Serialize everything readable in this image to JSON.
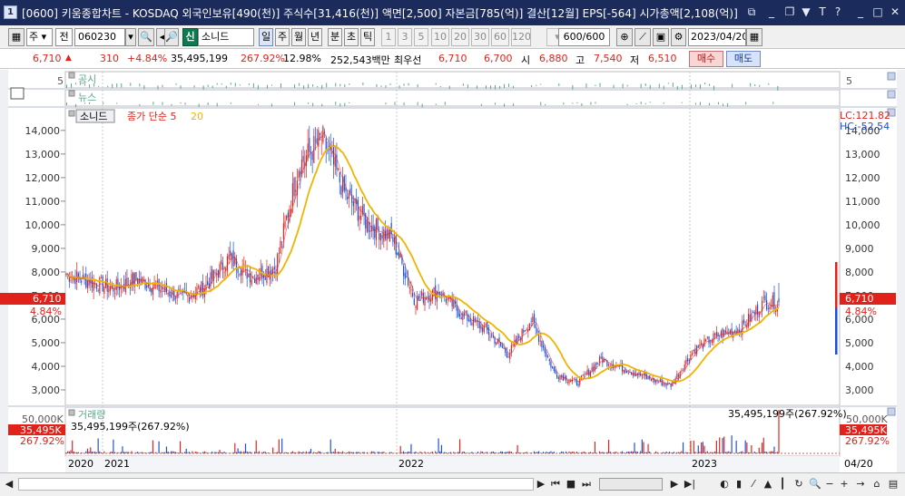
{
  "window": {
    "app_number": "1",
    "title": "[0600] 키움종합차트 - KOSDAQ 외국인보유[490(천)] 주식수[31,416(천)] 액면[2,500] 자본금[785(억)] 결산[12월] EPS[-564] 시가총액[2,108(억)]"
  },
  "toolbar": {
    "kind_label": "주",
    "prev_label": "전",
    "code_value": "060230",
    "credit_label": "신",
    "stock_name": "소니드",
    "periods": [
      "일",
      "주",
      "월",
      "년",
      "분",
      "초",
      "틱"
    ],
    "active_period": "일",
    "intervals": [
      "1",
      "3",
      "5",
      "10",
      "20",
      "30",
      "60",
      "120"
    ],
    "count_value": "600",
    "count_total": "/600",
    "date_value": "2023/04/20"
  },
  "quote": {
    "price": "6,710",
    "change": "310",
    "change_pct": "+4.84%",
    "volume": "35,495,199",
    "volume_ratio": "267.92%",
    "turnover": "12.98%",
    "amount": "252,543백만",
    "best_label": "최우선",
    "best_ask": "6,710",
    "best_bid": "6,700",
    "open_label": "시",
    "open": "6,880",
    "high_label": "고",
    "high": "7,540",
    "low_label": "저",
    "low": "6,510",
    "buy_label": "매수",
    "sell_label": "매도",
    "up_color": "#e0221b",
    "down_color": "#1d4fd6"
  },
  "panels": {
    "disclosure_label": "공시",
    "disclosure_scale": "5",
    "news_label": "뉴스",
    "price_legend_name": "소니드",
    "price_legend_ma": "종가 단순 5",
    "price_legend_ma2": "20",
    "lc_label": "LC:121.82",
    "hc_label": "HC:-52.54",
    "price_tag": "6,710",
    "price_tag_pct": "4.84%",
    "volume_label": "거래량",
    "volume_info_left": "35,495,199주(267.92%)",
    "volume_info_right": "35,495,199주(267.92%)",
    "volume_scale_top": "50,000K",
    "volume_tag": "35,495K",
    "volume_tag_pct": "267.92%"
  },
  "bottom": {
    "date_label": "04/20"
  },
  "chart_data": {
    "type": "candlestick",
    "ylim": [
      2500,
      14800
    ],
    "yticks": [
      "14,000",
      "13,000",
      "12,000",
      "11,000",
      "10,000",
      "9,000",
      "8,000",
      "7,000",
      "6,000",
      "5,000",
      "4,000",
      "3,000"
    ],
    "xticks": [
      "2020",
      "2021",
      "2022",
      "2023"
    ],
    "ma5_color": "#e0221b",
    "ma20_color": "#f0b400",
    "price_path": [
      [
        "2020-10",
        7900
      ],
      [
        "2020-12",
        7300
      ],
      [
        "2021-01",
        7700
      ],
      [
        "2021-03",
        6900
      ],
      [
        "2021-04",
        7400
      ],
      [
        "2021-05",
        8600
      ],
      [
        "2021-06",
        7800
      ],
      [
        "2021-07",
        8200
      ],
      [
        "2021-08",
        12500
      ],
      [
        "2021-09",
        13700
      ],
      [
        "2021-10",
        11300
      ],
      [
        "2021-11",
        10000
      ],
      [
        "2021-12",
        9500
      ],
      [
        "2022-01",
        6800
      ],
      [
        "2022-02",
        7200
      ],
      [
        "2022-03",
        6200
      ],
      [
        "2022-04",
        5600
      ],
      [
        "2022-05",
        4500
      ],
      [
        "2022-06",
        6000
      ],
      [
        "2022-07",
        3700
      ],
      [
        "2022-08",
        3300
      ],
      [
        "2022-09",
        4300
      ],
      [
        "2022-10",
        3900
      ],
      [
        "2022-11",
        3500
      ],
      [
        "2022-12",
        3200
      ],
      [
        "2023-01",
        4700
      ],
      [
        "2023-02",
        5300
      ],
      [
        "2023-03",
        5600
      ],
      [
        "2023-04",
        6710
      ]
    ],
    "last_close": 6710,
    "last_high": 7540,
    "last_low": 6510,
    "last_volume": 35495199
  }
}
